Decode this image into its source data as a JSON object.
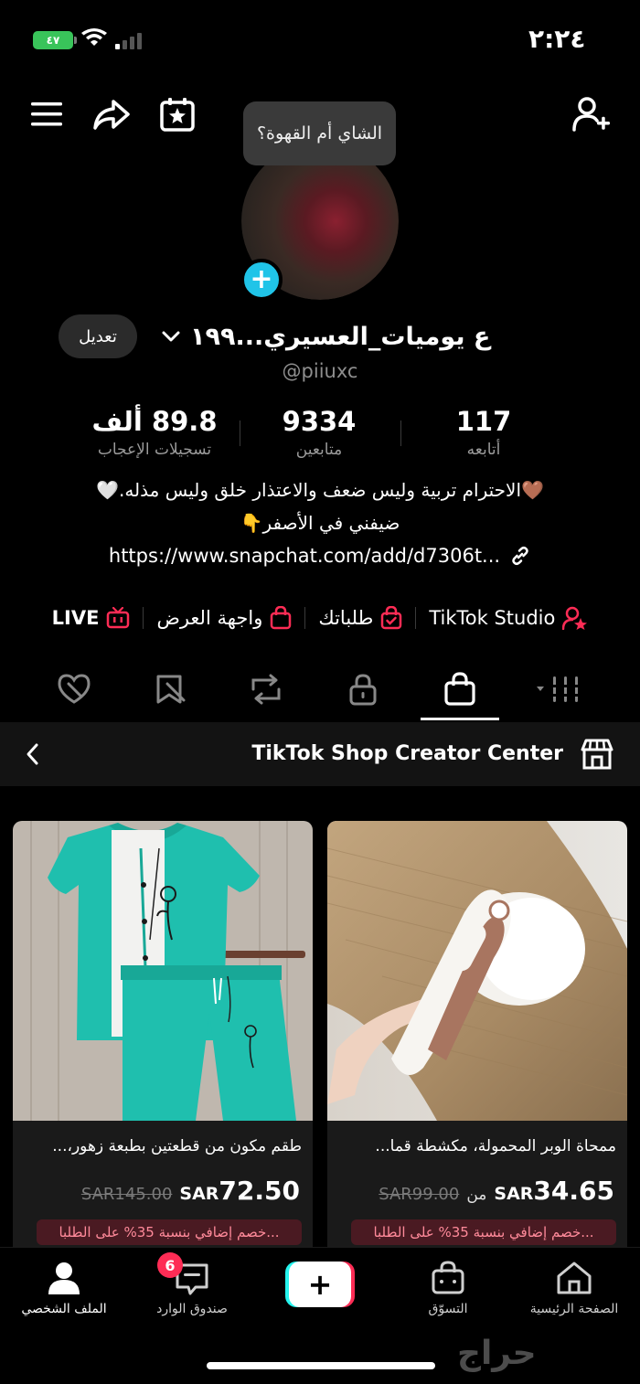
{
  "status_bar": {
    "time": "٢:٢٤",
    "battery": "٤٧"
  },
  "tooltip": "الشاي أم القهوة؟",
  "profile": {
    "edit_label": "تعديل",
    "name": "ع يوميات_العسيري...١٩٩",
    "handle": "@piiuxc",
    "stats": [
      {
        "num": "117",
        "label": "أتابعه"
      },
      {
        "num": "9334",
        "label": "متابعين"
      },
      {
        "num": "89.8 ألف",
        "label": "تسجيلات الإعجاب"
      }
    ],
    "bio_line1": "🤎الاحترام تربية وليس ضعف والاعتذار خلق وليس مذله.🤍",
    "bio_line2": "ضيفني في الأصفر👇",
    "link": "https://www.snapchat.com/add/d7306t..."
  },
  "quick_links": {
    "studio": "TikTok Studio",
    "orders": "طلباتك",
    "showcase": "واجهة العرض",
    "live": "LIVE"
  },
  "shop": {
    "title": "TikTok Shop Creator Center",
    "products": [
      {
        "title": "ممحاة الوبر المحمولة، مكشطة قما...",
        "price": "34.65",
        "currency": "SAR",
        "from_label": "من",
        "old_price": "SAR99.00",
        "discount": "خصم إضافي بنسبة 35% على الطلبا..."
      },
      {
        "title": "طقم مكون من قطعتين بطبعة زهور،...",
        "price": "72.50",
        "currency": "SAR",
        "old_price": "SAR145.00",
        "discount": "خصم إضافي بنسبة 35% على الطلبا..."
      }
    ]
  },
  "bottom_nav": {
    "home": "الصفحة الرئيسية",
    "shop": "التسوّق",
    "inbox": "صندوق الوارد",
    "inbox_badge": "6",
    "profile": "الملف الشخصي"
  },
  "watermark": "حراج",
  "colors": {
    "accent_cyan": "#20c4e8",
    "tiktok_red": "#fe2c55",
    "tiktok_cyan": "#25f4ee",
    "discount_bg": "#4a1a22"
  }
}
